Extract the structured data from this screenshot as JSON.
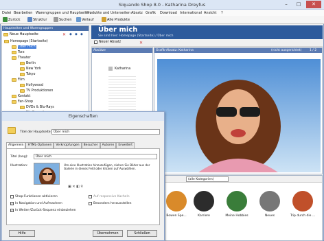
{
  "window": {
    "title": "Siquando Shop 8.0 - Katharina Dreyfus",
    "min": "–",
    "max": "□",
    "close": "✕"
  },
  "menu": [
    "Datei",
    "Bearbeiten",
    "Warengruppen und Hauptseiten",
    "Produkte und Unterseiten",
    "Absatz",
    "Grafik",
    "Download",
    "International",
    "Ansicht",
    "?"
  ],
  "toolbar": {
    "back": "Zurück",
    "struct": "Struktur",
    "search": "Suchen",
    "history": "Verlauf",
    "all": "Alle Produkte"
  },
  "left": {
    "header": "Hauptseiten und Warengruppen",
    "new_page": "Neue Hauptseite",
    "tree": [
      "Homepage (Startseite)",
      "Über mich",
      "Torz",
      "Theater",
      "Berlin",
      "New York",
      "Tokyo",
      "Film",
      "Hollywood",
      "TV Produktionen",
      "Kontakt",
      "Fan-Shop",
      "DVDs & Blu-Rays",
      "Für Sammler"
    ]
  },
  "main": {
    "title": "Über mich",
    "breadcrumb": "Sie sind hier: Homepage (Startseite) / Über mich",
    "new_paragraph": "Neuer Absatz",
    "col_absatz": "Absätze",
    "col_grafik": "Grafik-Absatz: Katharina",
    "col_right": "(nicht ausgerichtet)",
    "col_count": "1 / 2",
    "para_item": "Katharina",
    "category_filter": "(alle Kategorien)"
  },
  "gallery": {
    "items": [
      "Bowen Spe...",
      "Karriere",
      "Meine Hobbies",
      "Neues",
      "Trip durch die ..."
    ],
    "colors": [
      "#d98a2a",
      "#2c2c2c",
      "#3a7d3a",
      "#777777",
      "#c0502a"
    ]
  },
  "dialog": {
    "title": "Eigenschaften",
    "title_label": "Titel der Hauptseite:",
    "title_value": "Über mich",
    "tabs": [
      "Allgemein",
      "HTML-Optionen",
      "Verknüpfungen",
      "Besucher",
      "Autoren",
      "Erweitert"
    ],
    "short_label": "Titel (lang):",
    "short_value": "Über mich",
    "illus_label": "Illustration:",
    "illus_text": "Um eine Illustration hinzuzufügen, ziehen Sie Bilder aus der Galerie in dieses Feld oder klicken auf Auswählen.",
    "checks": [
      {
        "label": "Shop-Funktionen aktivieren",
        "checked": false
      },
      {
        "label": "In Navigation und Aufmachern",
        "checked": true
      },
      {
        "label": "In Weiter-/Zurück-Sequenz einbeziehen",
        "checked": true
      },
      {
        "label": "Auf responsive Kacheln",
        "checked": false
      },
      {
        "label": "Besonders herausstellen",
        "checked": false
      }
    ],
    "help": "Hilfe",
    "ok": "Übernehmen",
    "close": "Schließen"
  }
}
